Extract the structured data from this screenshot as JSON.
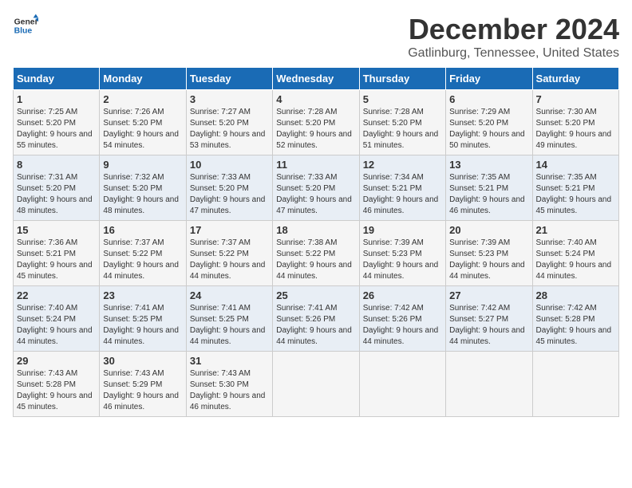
{
  "logo": {
    "text_general": "General",
    "text_blue": "Blue"
  },
  "header": {
    "month_title": "December 2024",
    "location": "Gatlinburg, Tennessee, United States"
  },
  "days_of_week": [
    "Sunday",
    "Monday",
    "Tuesday",
    "Wednesday",
    "Thursday",
    "Friday",
    "Saturday"
  ],
  "weeks": [
    [
      {
        "day": "1",
        "sunrise": "Sunrise: 7:25 AM",
        "sunset": "Sunset: 5:20 PM",
        "daylight": "Daylight: 9 hours and 55 minutes."
      },
      {
        "day": "2",
        "sunrise": "Sunrise: 7:26 AM",
        "sunset": "Sunset: 5:20 PM",
        "daylight": "Daylight: 9 hours and 54 minutes."
      },
      {
        "day": "3",
        "sunrise": "Sunrise: 7:27 AM",
        "sunset": "Sunset: 5:20 PM",
        "daylight": "Daylight: 9 hours and 53 minutes."
      },
      {
        "day": "4",
        "sunrise": "Sunrise: 7:28 AM",
        "sunset": "Sunset: 5:20 PM",
        "daylight": "Daylight: 9 hours and 52 minutes."
      },
      {
        "day": "5",
        "sunrise": "Sunrise: 7:28 AM",
        "sunset": "Sunset: 5:20 PM",
        "daylight": "Daylight: 9 hours and 51 minutes."
      },
      {
        "day": "6",
        "sunrise": "Sunrise: 7:29 AM",
        "sunset": "Sunset: 5:20 PM",
        "daylight": "Daylight: 9 hours and 50 minutes."
      },
      {
        "day": "7",
        "sunrise": "Sunrise: 7:30 AM",
        "sunset": "Sunset: 5:20 PM",
        "daylight": "Daylight: 9 hours and 49 minutes."
      }
    ],
    [
      {
        "day": "8",
        "sunrise": "Sunrise: 7:31 AM",
        "sunset": "Sunset: 5:20 PM",
        "daylight": "Daylight: 9 hours and 48 minutes."
      },
      {
        "day": "9",
        "sunrise": "Sunrise: 7:32 AM",
        "sunset": "Sunset: 5:20 PM",
        "daylight": "Daylight: 9 hours and 48 minutes."
      },
      {
        "day": "10",
        "sunrise": "Sunrise: 7:33 AM",
        "sunset": "Sunset: 5:20 PM",
        "daylight": "Daylight: 9 hours and 47 minutes."
      },
      {
        "day": "11",
        "sunrise": "Sunrise: 7:33 AM",
        "sunset": "Sunset: 5:20 PM",
        "daylight": "Daylight: 9 hours and 47 minutes."
      },
      {
        "day": "12",
        "sunrise": "Sunrise: 7:34 AM",
        "sunset": "Sunset: 5:21 PM",
        "daylight": "Daylight: 9 hours and 46 minutes."
      },
      {
        "day": "13",
        "sunrise": "Sunrise: 7:35 AM",
        "sunset": "Sunset: 5:21 PM",
        "daylight": "Daylight: 9 hours and 46 minutes."
      },
      {
        "day": "14",
        "sunrise": "Sunrise: 7:35 AM",
        "sunset": "Sunset: 5:21 PM",
        "daylight": "Daylight: 9 hours and 45 minutes."
      }
    ],
    [
      {
        "day": "15",
        "sunrise": "Sunrise: 7:36 AM",
        "sunset": "Sunset: 5:21 PM",
        "daylight": "Daylight: 9 hours and 45 minutes."
      },
      {
        "day": "16",
        "sunrise": "Sunrise: 7:37 AM",
        "sunset": "Sunset: 5:22 PM",
        "daylight": "Daylight: 9 hours and 44 minutes."
      },
      {
        "day": "17",
        "sunrise": "Sunrise: 7:37 AM",
        "sunset": "Sunset: 5:22 PM",
        "daylight": "Daylight: 9 hours and 44 minutes."
      },
      {
        "day": "18",
        "sunrise": "Sunrise: 7:38 AM",
        "sunset": "Sunset: 5:22 PM",
        "daylight": "Daylight: 9 hours and 44 minutes."
      },
      {
        "day": "19",
        "sunrise": "Sunrise: 7:39 AM",
        "sunset": "Sunset: 5:23 PM",
        "daylight": "Daylight: 9 hours and 44 minutes."
      },
      {
        "day": "20",
        "sunrise": "Sunrise: 7:39 AM",
        "sunset": "Sunset: 5:23 PM",
        "daylight": "Daylight: 9 hours and 44 minutes."
      },
      {
        "day": "21",
        "sunrise": "Sunrise: 7:40 AM",
        "sunset": "Sunset: 5:24 PM",
        "daylight": "Daylight: 9 hours and 44 minutes."
      }
    ],
    [
      {
        "day": "22",
        "sunrise": "Sunrise: 7:40 AM",
        "sunset": "Sunset: 5:24 PM",
        "daylight": "Daylight: 9 hours and 44 minutes."
      },
      {
        "day": "23",
        "sunrise": "Sunrise: 7:41 AM",
        "sunset": "Sunset: 5:25 PM",
        "daylight": "Daylight: 9 hours and 44 minutes."
      },
      {
        "day": "24",
        "sunrise": "Sunrise: 7:41 AM",
        "sunset": "Sunset: 5:25 PM",
        "daylight": "Daylight: 9 hours and 44 minutes."
      },
      {
        "day": "25",
        "sunrise": "Sunrise: 7:41 AM",
        "sunset": "Sunset: 5:26 PM",
        "daylight": "Daylight: 9 hours and 44 minutes."
      },
      {
        "day": "26",
        "sunrise": "Sunrise: 7:42 AM",
        "sunset": "Sunset: 5:26 PM",
        "daylight": "Daylight: 9 hours and 44 minutes."
      },
      {
        "day": "27",
        "sunrise": "Sunrise: 7:42 AM",
        "sunset": "Sunset: 5:27 PM",
        "daylight": "Daylight: 9 hours and 44 minutes."
      },
      {
        "day": "28",
        "sunrise": "Sunrise: 7:42 AM",
        "sunset": "Sunset: 5:28 PM",
        "daylight": "Daylight: 9 hours and 45 minutes."
      }
    ],
    [
      {
        "day": "29",
        "sunrise": "Sunrise: 7:43 AM",
        "sunset": "Sunset: 5:28 PM",
        "daylight": "Daylight: 9 hours and 45 minutes."
      },
      {
        "day": "30",
        "sunrise": "Sunrise: 7:43 AM",
        "sunset": "Sunset: 5:29 PM",
        "daylight": "Daylight: 9 hours and 46 minutes."
      },
      {
        "day": "31",
        "sunrise": "Sunrise: 7:43 AM",
        "sunset": "Sunset: 5:30 PM",
        "daylight": "Daylight: 9 hours and 46 minutes."
      },
      null,
      null,
      null,
      null
    ]
  ]
}
